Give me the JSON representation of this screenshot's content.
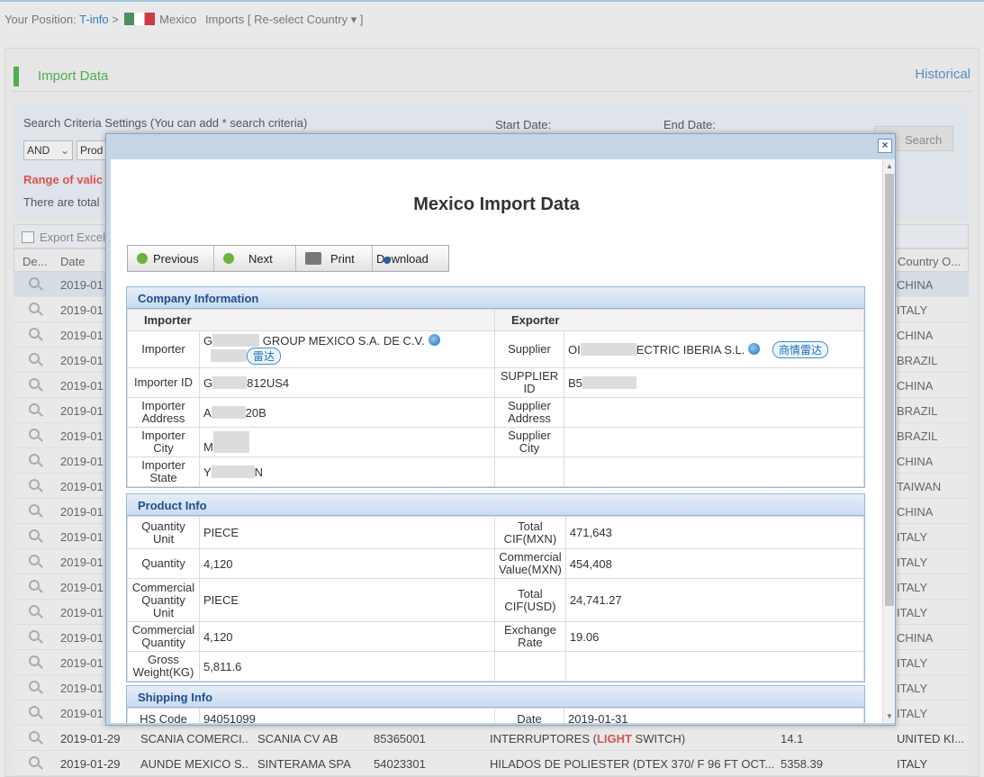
{
  "breadcrumb": {
    "prefix": "Your Position:",
    "tinfo": "T-info",
    "sep": ">",
    "country": "Mexico",
    "section": "Imports",
    "reselect": "[ Re-select Country ▾ ]"
  },
  "panel": {
    "title": "Import Data",
    "historical": "Historical"
  },
  "search": {
    "criteria_label": "Search Criteria Settings (You can add * search criteria)",
    "start_date_label": "Start Date:",
    "end_date_label": "End Date:",
    "logic_value": "AND",
    "field_value": "Prod",
    "search_button": "Search",
    "range_text": "Range of valic",
    "total_text": "There are total"
  },
  "export_label": "Export Excel",
  "table": {
    "headers": [
      "De...",
      "Date",
      "Country O..."
    ],
    "rows": [
      {
        "date": "2019-01",
        "country": "CHINA"
      },
      {
        "date": "2019-01",
        "country": "ITALY"
      },
      {
        "date": "2019-01",
        "country": "CHINA"
      },
      {
        "date": "2019-01",
        "country": "BRAZIL"
      },
      {
        "date": "2019-01",
        "country": "CHINA"
      },
      {
        "date": "2019-01",
        "country": "BRAZIL"
      },
      {
        "date": "2019-01",
        "country": "BRAZIL"
      },
      {
        "date": "2019-01",
        "country": "CHINA"
      },
      {
        "date": "2019-01",
        "country": "TAIWAN"
      },
      {
        "date": "2019-01",
        "country": "CHINA"
      },
      {
        "date": "2019-01",
        "country": "ITALY"
      },
      {
        "date": "2019-01",
        "country": "ITALY"
      },
      {
        "date": "2019-01",
        "country": "ITALY"
      },
      {
        "date": "2019-01",
        "country": "ITALY"
      },
      {
        "date": "2019-01",
        "country": "CHINA"
      },
      {
        "date": "2019-01",
        "country": "ITALY"
      },
      {
        "date": "2019-01",
        "country": "ITALY"
      },
      {
        "date": "2019-01",
        "country": "ITALY"
      }
    ],
    "full_rows": [
      {
        "date": "2019-01-29",
        "importer": "SCANIA COMERCI...",
        "exporter": "SCANIA CV AB",
        "hs": "85365001",
        "desc_pre": "INTERRUPTORES (",
        "desc_hl": "LIGHT",
        "desc_post": " SWITCH)",
        "value": "14.1",
        "country": "UNITED KI..."
      },
      {
        "date": "2019-01-29",
        "importer": "AUNDE MEXICO S...",
        "exporter": "SINTERAMA SPA",
        "hs": "54023301",
        "desc_pre": "HILADOS DE POLIESTER (DTEX 370/ F 96 FT OCT...",
        "desc_hl": "",
        "desc_post": "",
        "value": "5358.39",
        "country": "ITALY"
      }
    ]
  },
  "modal": {
    "title": "Mexico Import Data",
    "buttons": {
      "previous": "Previous",
      "next": "Next",
      "print": "Print",
      "download": "Download"
    },
    "company": {
      "heading": "Company Information",
      "importer_col": "Importer",
      "exporter_col": "Exporter",
      "importer_label": "Importer",
      "importer_pre": "G",
      "importer_post": "GROUP MEXICO S.A. DE C.V.",
      "importer_tag": "雷达",
      "supplier_label": "Supplier",
      "supplier_pre": "OI",
      "supplier_post": "ECTRIC IBERIA S.L.",
      "supplier_tag": "商情雷达",
      "importer_id_label": "Importer ID",
      "importer_id_pre": "G",
      "importer_id_post": "812US4",
      "supplier_id_label": "SUPPLIER ID",
      "supplier_id_pre": "B5",
      "importer_address_label": "Importer Address",
      "importer_address_pre": "A",
      "importer_address_post": "20B",
      "supplier_address_label": "Supplier Address",
      "importer_city_label": "Importer City",
      "importer_city_pre": "M",
      "supplier_city_label": "Supplier City",
      "importer_state_label": "Importer State",
      "importer_state_pre": "Y",
      "importer_state_post": "N"
    },
    "product": {
      "heading": "Product Info",
      "rows": [
        {
          "l1": "Quantity Unit",
          "v1": "PIECE",
          "l2": "Total CIF(MXN)",
          "v2": "471,643"
        },
        {
          "l1": "Quantity",
          "v1": "4,120",
          "l2": "Commercial Value(MXN)",
          "v2": "454,408"
        },
        {
          "l1": "Commercial Quantity Unit",
          "v1": "PIECE",
          "l2": "Total CIF(USD)",
          "v2": "24,741.27"
        },
        {
          "l1": "Commercial Quantity",
          "v1": "4,120",
          "l2": "Exchange Rate",
          "v2": "19.06"
        },
        {
          "l1": "Gross Weight(KG)",
          "v1": "5,811.6",
          "l2": "",
          "v2": ""
        }
      ]
    },
    "shipping": {
      "heading": "Shipping Info",
      "hs_label": "HS Code",
      "hs_value": "94051099",
      "date_label": "Date",
      "date_value": "2019-01-31"
    }
  }
}
